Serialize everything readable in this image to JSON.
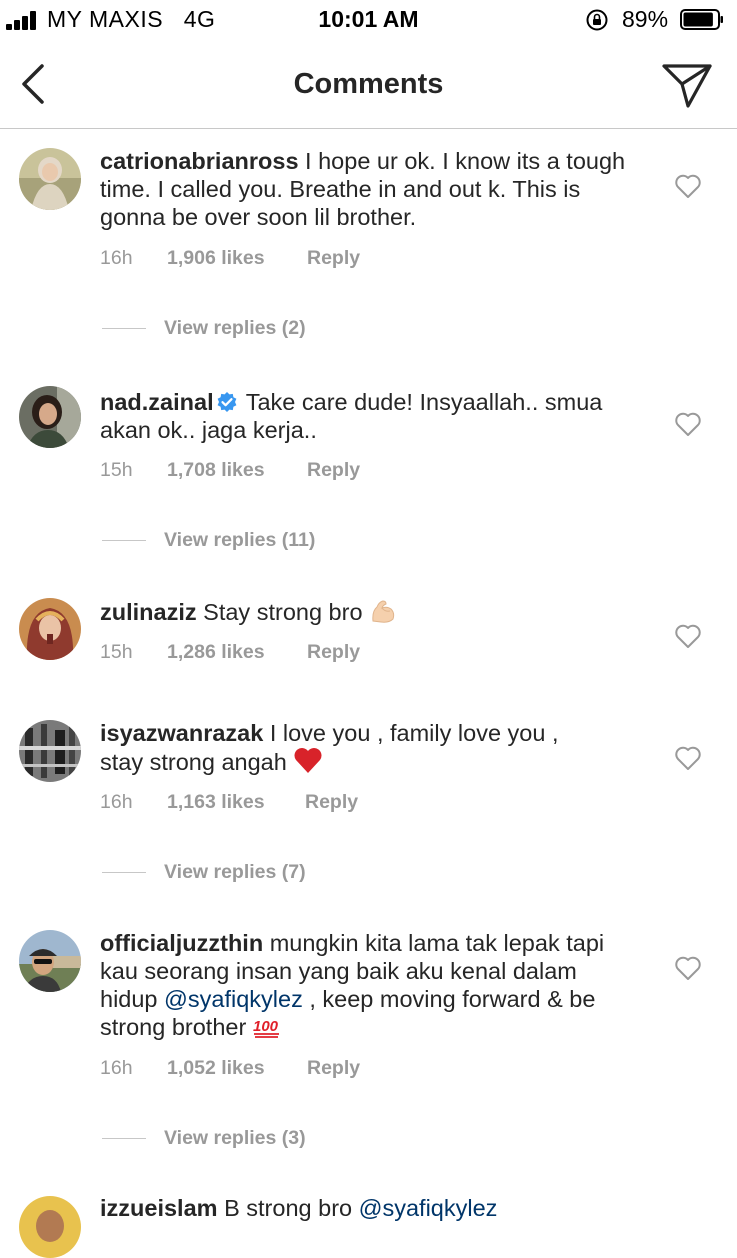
{
  "status_bar": {
    "carrier": "MY MAXIS",
    "network": "4G",
    "time": "10:01 AM",
    "battery_percent": "89%",
    "battery_level": 0.89
  },
  "nav": {
    "title": "Comments",
    "back_icon": "chevron-left-icon",
    "send_icon": "paper-plane-icon"
  },
  "comments": [
    {
      "username": "catrionabrianross",
      "text": "I hope ur ok. I know its a tough time. I called you. Breathe in and out k. This is gonna be over soon lil brother.",
      "time": "16h",
      "likes": "1,906 likes",
      "reply": "Reply",
      "view_replies": "View replies (2)"
    },
    {
      "username": "nad.zainal",
      "verified": true,
      "text": "Take care dude! Insyaallah.. smua akan ok.. jaga kerja..",
      "time": "15h",
      "likes": "1,708 likes",
      "reply": "Reply",
      "view_replies": "View replies (11)"
    },
    {
      "username": "zulinaziz",
      "text": "Stay strong bro",
      "emoji": "flexed-biceps-emoji",
      "time": "15h",
      "likes": "1,286 likes",
      "reply": "Reply"
    },
    {
      "username": "isyazwanrazak",
      "text_line1": "I love you , family love you ,",
      "text_line2": "stay strong angah",
      "emoji": "red-heart-emoji",
      "time": "16h",
      "likes": "1,163 likes",
      "reply": "Reply",
      "view_replies": "View replies (7)"
    },
    {
      "username": "officialjuzzthin",
      "text_a": "mungkin kita lama tak lepak tapi kau seorang insan yang baik aku kenal dalam hidup",
      "mention": "@syafiqkylez",
      "text_b": ", keep moving forward & be strong brother",
      "emoji": "hundred-points-emoji",
      "time": "16h",
      "likes": "1,052 likes",
      "reply": "Reply",
      "view_replies": "View replies (3)"
    },
    {
      "username": "izzueislam",
      "text": "B strong bro",
      "mention": "@syafiqkylez"
    }
  ],
  "colors": {
    "text": "#262626",
    "meta": "#999999",
    "mention": "#003569",
    "verified": "#3897f0"
  }
}
